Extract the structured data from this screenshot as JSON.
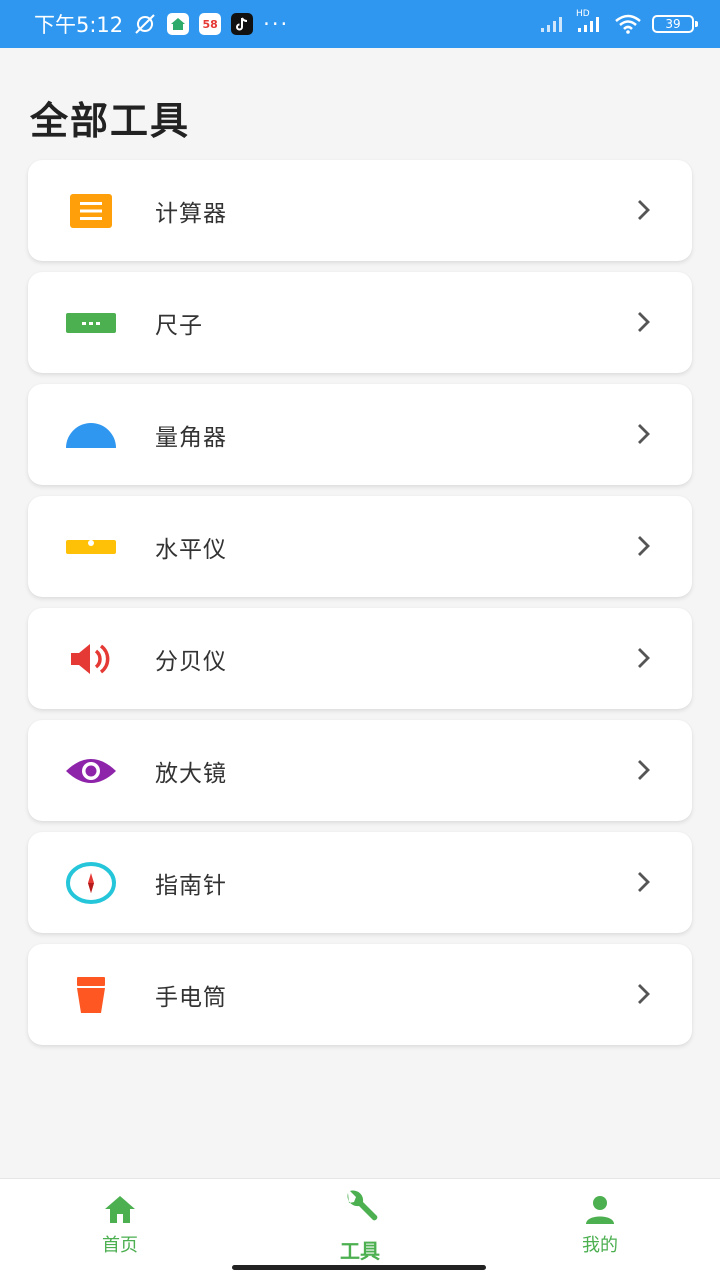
{
  "status_bar": {
    "time": "下午5:12",
    "app_badge_58": "58",
    "more": "···",
    "network": "HD",
    "battery": "39"
  },
  "page": {
    "title": "全部工具"
  },
  "tools": [
    {
      "label": "计算器",
      "icon": "calculator-icon",
      "color": "#ff9f0a"
    },
    {
      "label": "尺子",
      "icon": "ruler-icon",
      "color": "#4caf50"
    },
    {
      "label": "量角器",
      "icon": "protractor-icon",
      "color": "#2f97f0"
    },
    {
      "label": "水平仪",
      "icon": "level-icon",
      "color": "#ffc107"
    },
    {
      "label": "分贝仪",
      "icon": "speaker-icon",
      "color": "#e53935"
    },
    {
      "label": "放大镜",
      "icon": "eye-icon",
      "color": "#8e24aa"
    },
    {
      "label": "指南针",
      "icon": "compass-icon",
      "color": "#26c6da"
    },
    {
      "label": "手电筒",
      "icon": "flashlight-icon",
      "color": "#ff5722"
    }
  ],
  "bottom_nav": {
    "home": "首页",
    "tools": "工具",
    "mine": "我的",
    "accent": "#4caf50"
  }
}
